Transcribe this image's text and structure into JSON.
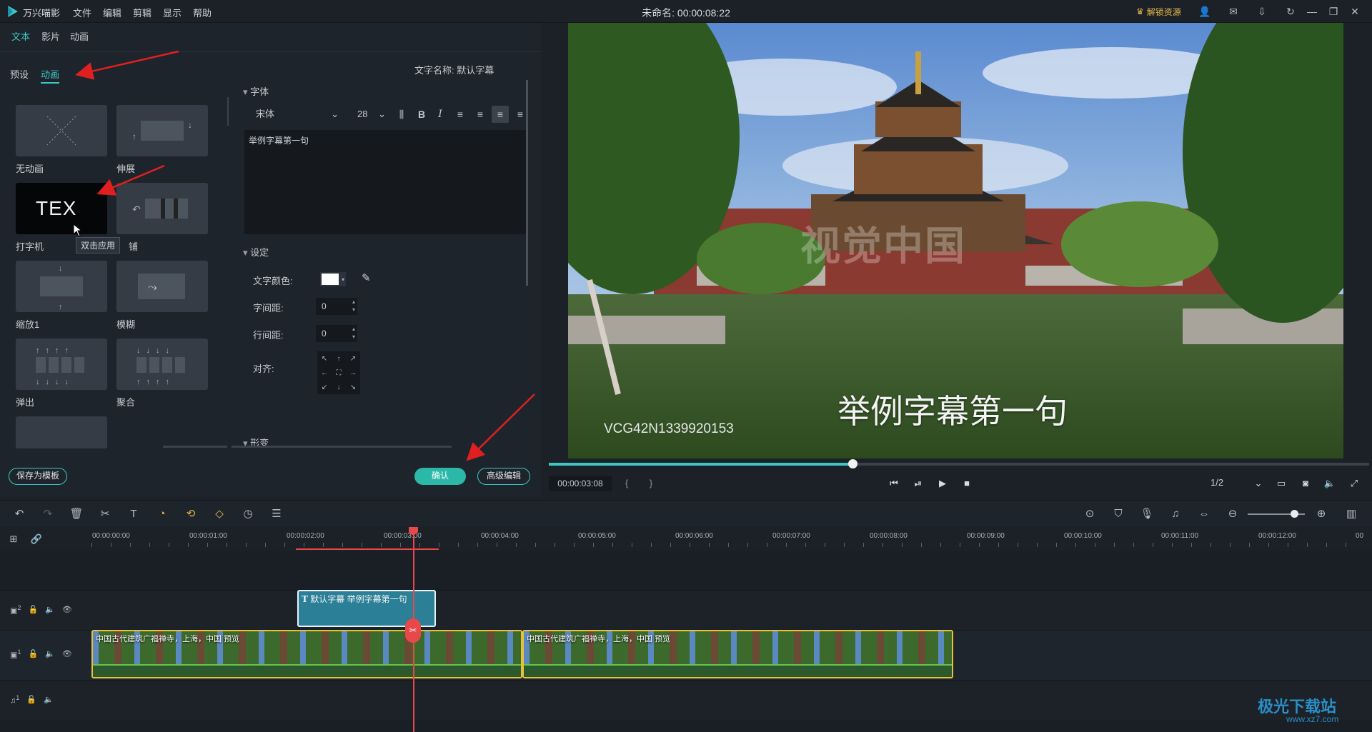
{
  "app": {
    "name": "万兴喵影",
    "doc_title": "未命名: 00:00:08:22",
    "unlock_label": "解锁资源"
  },
  "menu": [
    "文件",
    "编辑",
    "剪辑",
    "显示",
    "帮助"
  ],
  "top_tabs": [
    "文本",
    "影片",
    "动画"
  ],
  "sub_tabs": [
    "预设",
    "动画"
  ],
  "animations": [
    {
      "label": "无动画",
      "icon": "cross-dots-icon"
    },
    {
      "label": "伸展",
      "icon": "stretch-icon"
    },
    {
      "label": "打字机",
      "icon": "typewriter-icon",
      "thumb_text": "TEX"
    },
    {
      "label": "铺",
      "icon": "lay-icon"
    },
    {
      "label": "缩放1",
      "icon": "zoom-icon"
    },
    {
      "label": "模糊",
      "icon": "blur-icon"
    },
    {
      "label": "弹出",
      "icon": "pop-icon"
    },
    {
      "label": "聚合",
      "icon": "gather-icon"
    }
  ],
  "tooltip": "双击应用",
  "text_name": "文字名称: 默认字幕",
  "font_section": "字体",
  "font": {
    "family": "宋体",
    "size": "28"
  },
  "text_content": "举例字幕第一句",
  "settings_section": "设定",
  "settings": {
    "color_label": "文字颜色:",
    "spacing_label": "字间距:",
    "spacing_value": "0",
    "line_label": "行间距:",
    "line_value": "0",
    "align_label": "对齐:"
  },
  "transform_section": "形变",
  "buttons": {
    "save_template": "保存为模板",
    "confirm": "确认",
    "advanced": "高级编辑"
  },
  "preview": {
    "caption": "举例字幕第一句",
    "watermark_id": "VCG42N1339920153",
    "watermark_text": "视觉中国",
    "timecode": "00:00:03:08",
    "progress": 0.37,
    "ratio": "1/2"
  },
  "ruler": [
    "00:00:00:00",
    "00:00:01:00",
    "00:00:02:00",
    "00:00:03:00",
    "00:00:04:00",
    "00:00:05:00",
    "00:00:06:00",
    "00:00:07:00",
    "00:00:08:00",
    "00:00:09:00",
    "00:00:10:00",
    "00:00:11:00",
    "00:00:12:00",
    "00"
  ],
  "tracks": {
    "t2_label": "2",
    "t1_label": "1",
    "a1_label": "1",
    "title_clip": "默认字幕 举例字幕第一句",
    "video_clip_a": "中国古代建筑广福禅寺，上海，中国 预览",
    "video_clip_b": "中国古代建筑广福禅寺，上海，中国 预览"
  },
  "brand": {
    "name": "极光下载站",
    "url": "www.xz7.com"
  },
  "colors": {
    "accent": "#3fc7c3",
    "clip_yellow": "#e6c23a",
    "playhead": "#e8484a",
    "title_clip": "#2b7f96"
  }
}
